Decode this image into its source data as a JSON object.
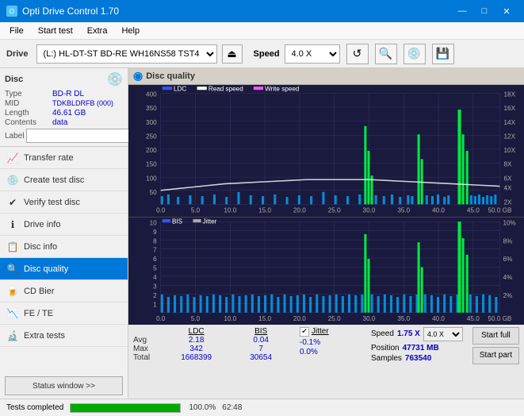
{
  "titleBar": {
    "title": "Opti Drive Control 1.70",
    "minBtn": "—",
    "maxBtn": "□",
    "closeBtn": "✕"
  },
  "menuBar": {
    "items": [
      "File",
      "Start test",
      "Extra",
      "Help"
    ]
  },
  "driveBar": {
    "driveLabel": "Drive",
    "driveValue": "(L:)  HL-DT-ST BD-RE  WH16NS58 TST4",
    "speedLabel": "Speed",
    "speedValue": "4.0 X"
  },
  "disc": {
    "title": "Disc",
    "typeLabel": "Type",
    "typeValue": "BD-R DL",
    "midLabel": "MID",
    "midValue": "TDKBLDRFB (000)",
    "lengthLabel": "Length",
    "lengthValue": "46.61 GB",
    "contentsLabel": "Contents",
    "contentsValue": "data",
    "labelLabel": "Label",
    "labelValue": ""
  },
  "nav": {
    "items": [
      {
        "id": "transfer-rate",
        "label": "Transfer rate",
        "icon": "📈"
      },
      {
        "id": "create-test-disc",
        "label": "Create test disc",
        "icon": "💿"
      },
      {
        "id": "verify-test-disc",
        "label": "Verify test disc",
        "icon": "✅"
      },
      {
        "id": "drive-info",
        "label": "Drive info",
        "icon": "ℹ️"
      },
      {
        "id": "disc-info",
        "label": "Disc info",
        "icon": "📋"
      },
      {
        "id": "disc-quality",
        "label": "Disc quality",
        "icon": "🔍",
        "active": true
      },
      {
        "id": "cd-bier",
        "label": "CD Bier",
        "icon": "🍺"
      },
      {
        "id": "fe-te",
        "label": "FE / TE",
        "icon": "📉"
      },
      {
        "id": "extra-tests",
        "label": "Extra tests",
        "icon": "🔬"
      }
    ],
    "statusWindowBtn": "Status window >>"
  },
  "chartHeader": {
    "title": "Disc quality"
  },
  "topChart": {
    "legend": [
      {
        "label": "LDC",
        "color": "#3355ff"
      },
      {
        "label": "Read speed",
        "color": "#ffffff"
      },
      {
        "label": "Write speed",
        "color": "#ff55ff"
      }
    ],
    "yAxisMax": 400,
    "yAxisLabels": [
      "400",
      "350",
      "300",
      "250",
      "200",
      "150",
      "100",
      "50"
    ],
    "yAxisRight": [
      "18X",
      "16X",
      "14X",
      "12X",
      "10X",
      "8X",
      "6X",
      "4X",
      "2X"
    ],
    "xAxisLabels": [
      "0.0",
      "5.0",
      "10.0",
      "15.0",
      "20.0",
      "25.0",
      "30.0",
      "35.0",
      "40.0",
      "45.0",
      "50.0 GB"
    ]
  },
  "bottomChart": {
    "legend": [
      {
        "label": "BIS",
        "color": "#3355ff"
      },
      {
        "label": "Jitter",
        "color": "#aaaaaa"
      }
    ],
    "yAxisLeft": [
      "10",
      "9",
      "8",
      "7",
      "6",
      "5",
      "4",
      "3",
      "2",
      "1"
    ],
    "yAxisRight": [
      "10%",
      "8%",
      "6%",
      "4%",
      "2%"
    ],
    "xAxisLabels": [
      "0.0",
      "5.0",
      "10.0",
      "15.0",
      "20.0",
      "25.0",
      "30.0",
      "35.0",
      "40.0",
      "45.0",
      "50.0 GB"
    ]
  },
  "stats": {
    "columns": [
      "",
      "LDC",
      "BIS",
      "",
      "Jitter",
      "Speed",
      "1.75 X",
      "4.0 X"
    ],
    "rows": [
      {
        "label": "Avg",
        "ldc": "2.18",
        "bis": "0.04",
        "jitter": "-0.1%"
      },
      {
        "label": "Max",
        "ldc": "342",
        "bis": "7",
        "jitter": "0.0%"
      },
      {
        "label": "Total",
        "ldc": "1668399",
        "bis": "30654",
        "jitter": ""
      }
    ],
    "positionLabel": "Position",
    "positionValue": "47731 MB",
    "samplesLabel": "Samples",
    "samplesValue": "763540",
    "jitterChecked": true,
    "startFullBtn": "Start full",
    "startPartBtn": "Start part"
  },
  "statusBar": {
    "text": "Tests completed",
    "progress": 100,
    "progressText": "100.0%",
    "time": "62:48"
  }
}
